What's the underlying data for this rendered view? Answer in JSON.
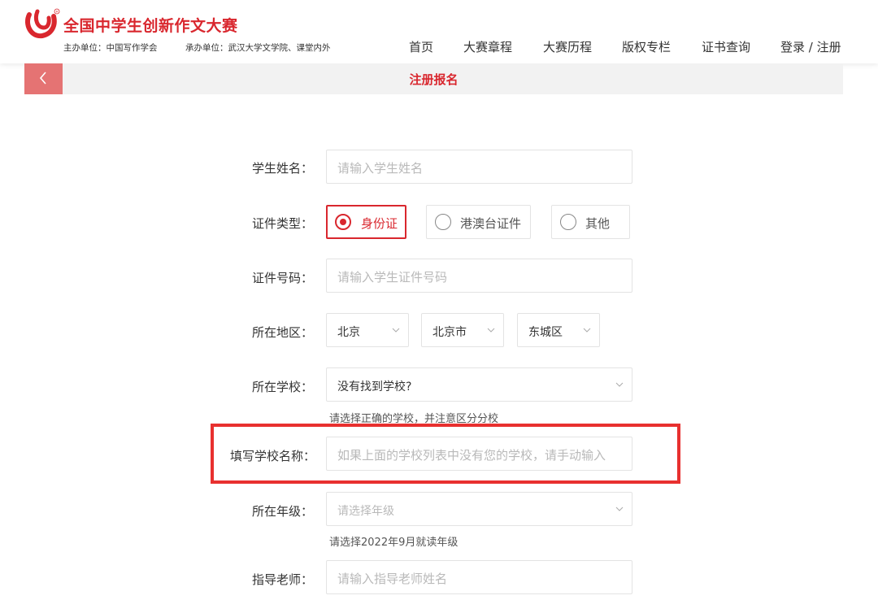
{
  "header": {
    "site_title": "全国中学生创新作文大赛",
    "organizer": "主办单位：中国写作学会",
    "co_organizer": "承办单位：武汉大学文学院、课堂内外",
    "logo_mark": "R"
  },
  "nav": {
    "items": [
      "首页",
      "大赛章程",
      "大赛历程",
      "版权专栏",
      "证书查询",
      "登录 / 注册"
    ]
  },
  "subheader": {
    "title": "注册报名",
    "back_icon": "chevron-left-icon"
  },
  "form": {
    "student_name": {
      "label": "学生姓名：",
      "placeholder": "请输入学生姓名"
    },
    "id_type": {
      "label": "证件类型：",
      "options": [
        "身份证",
        "港澳台证件",
        "其他"
      ],
      "selected": "身份证"
    },
    "id_number": {
      "label": "证件号码：",
      "placeholder": "请输入学生证件号码"
    },
    "region": {
      "label": "所在地区：",
      "province": "北京",
      "city": "北京市",
      "district": "东城区"
    },
    "school": {
      "label": "所在学校：",
      "value": "没有找到学校?",
      "hint": "请选择正确的学校，并注意区分分校"
    },
    "school_name": {
      "label": "填写学校名称：",
      "placeholder": "如果上面的学校列表中没有您的学校，请手动输入"
    },
    "grade": {
      "label": "所在年级：",
      "placeholder": "请选择年级",
      "hint": "请选择2022年9月就读年级"
    },
    "teacher": {
      "label": "指导老师：",
      "placeholder": "请输入指导老师姓名"
    }
  },
  "colors": {
    "brand_red": "#d9272e",
    "back_button_bg": "#e57373",
    "highlight_box": "#e8302f"
  }
}
